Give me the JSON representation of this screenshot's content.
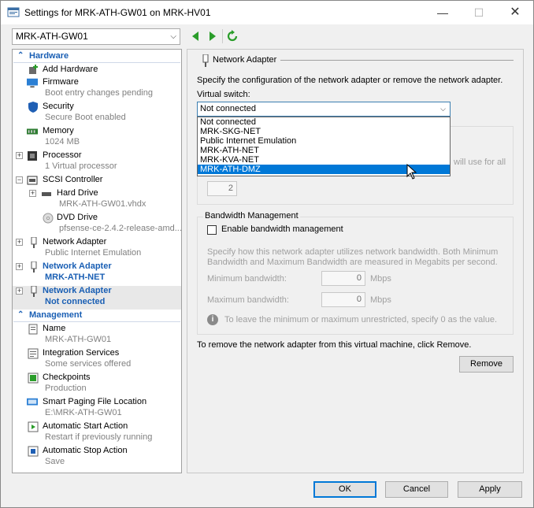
{
  "window": {
    "title": "Settings for MRK-ATH-GW01 on MRK-HV01",
    "min": "—",
    "max": "☐",
    "close": "✕"
  },
  "vm_selector": {
    "value": "MRK-ATH-GW01"
  },
  "tree": {
    "hardware_header": "Hardware",
    "management_header": "Management",
    "items": [
      {
        "label": "Add Hardware",
        "sub": ""
      },
      {
        "label": "Firmware",
        "sub": "Boot entry changes pending"
      },
      {
        "label": "Security",
        "sub": "Secure Boot enabled"
      },
      {
        "label": "Memory",
        "sub": "1024 MB"
      },
      {
        "label": "Processor",
        "sub": "1 Virtual processor"
      },
      {
        "label": "SCSI Controller",
        "sub": ""
      },
      {
        "label": "Hard Drive",
        "sub": "MRK-ATH-GW01.vhdx"
      },
      {
        "label": "DVD Drive",
        "sub": "pfsense-ce-2.4.2-release-amd..."
      },
      {
        "label": "Network Adapter",
        "sub": "Public Internet Emulation"
      },
      {
        "label": "Network Adapter",
        "sub": "MRK-ATH-NET"
      },
      {
        "label": "Network Adapter",
        "sub": "Not connected"
      },
      {
        "label": "Name",
        "sub": "MRK-ATH-GW01"
      },
      {
        "label": "Integration Services",
        "sub": "Some services offered"
      },
      {
        "label": "Checkpoints",
        "sub": "Production"
      },
      {
        "label": "Smart Paging File Location",
        "sub": "E:\\MRK-ATH-GW01"
      },
      {
        "label": "Automatic Start Action",
        "sub": "Restart if previously running"
      },
      {
        "label": "Automatic Stop Action",
        "sub": "Save"
      }
    ]
  },
  "panel": {
    "header": "Network Adapter",
    "description": "Specify the configuration of the network adapter or remove the network adapter.",
    "virtual_switch_label": "Virtual switch:",
    "virtual_switch_value": "Not connected",
    "options": [
      "Not connected",
      "MRK-SKG-NET",
      "Public Internet Emulation",
      "MRK-ATH-NET",
      "MRK-KVA-NET",
      "MRK-ATH-DMZ"
    ],
    "highlighted_option": "MRK-ATH-DMZ",
    "vlan_side_text": "will use for all",
    "vlan_id": "2",
    "bandwidth": {
      "legend": "Bandwidth Management",
      "checkbox_label": "Enable bandwidth management",
      "checked": false,
      "description": "Specify how this network adapter utilizes network bandwidth. Both Minimum Bandwidth and Maximum Bandwidth are measured in Megabits per second.",
      "min_label": "Minimum bandwidth:",
      "min_value": "0",
      "max_label": "Maximum bandwidth:",
      "max_value": "0",
      "unit": "Mbps",
      "info": "To leave the minimum or maximum unrestricted, specify 0 as the value."
    },
    "remove_description": "To remove the network adapter from this virtual machine, click Remove.",
    "remove_button": "Remove"
  },
  "footer": {
    "ok": "OK",
    "cancel": "Cancel",
    "apply": "Apply"
  },
  "colors": {
    "accent": "#0078d7",
    "tree_blue": "#1a5fb4",
    "disabled_text": "#a0a0a0"
  }
}
